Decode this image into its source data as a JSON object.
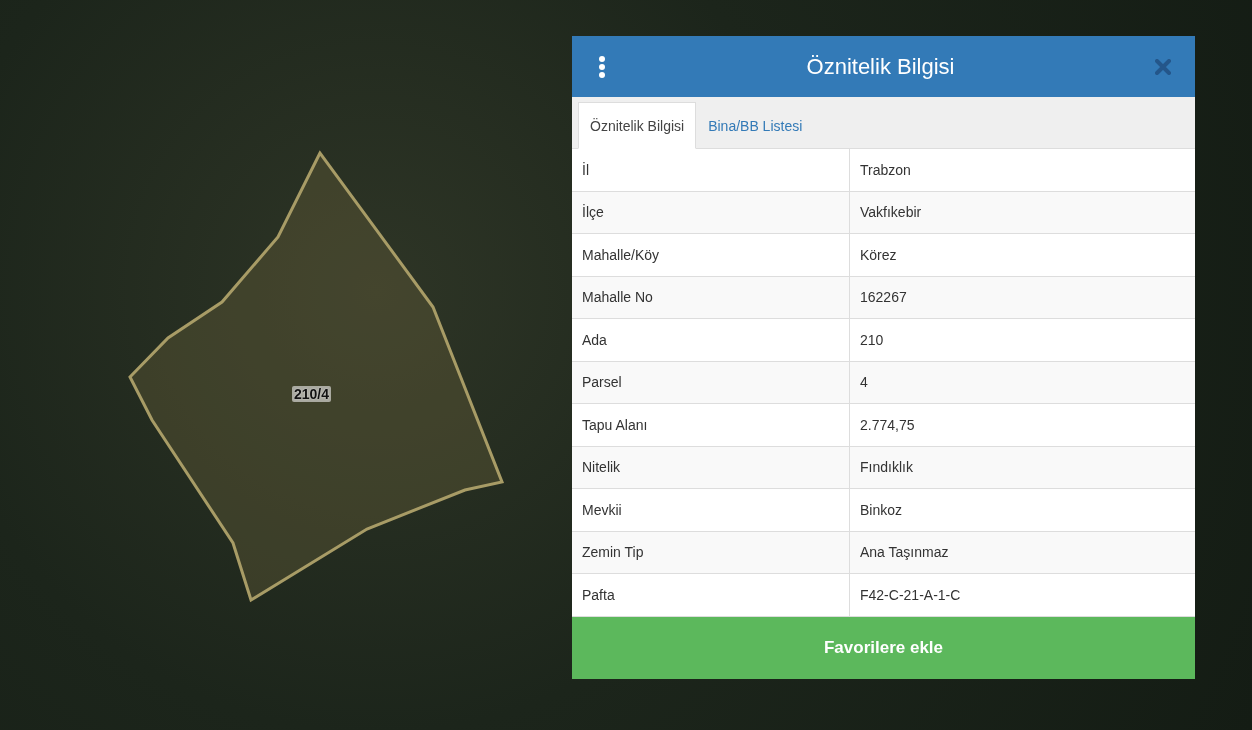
{
  "map": {
    "parcel_label": "210/4"
  },
  "panel": {
    "title": "Öznitelik Bilgisi",
    "tabs": [
      {
        "label": "Öznitelik Bilgisi",
        "selected": true
      },
      {
        "label": "Bina/BB Listesi",
        "selected": false
      }
    ],
    "rows": [
      {
        "label": "İl",
        "value": "Trabzon"
      },
      {
        "label": "İlçe",
        "value": "Vakfıkebir"
      },
      {
        "label": "Mahalle/Köy",
        "value": "Körez"
      },
      {
        "label": "Mahalle No",
        "value": "162267"
      },
      {
        "label": "Ada",
        "value": "210"
      },
      {
        "label": "Parsel",
        "value": "4"
      },
      {
        "label": "Tapu Alanı",
        "value": "2.774,75"
      },
      {
        "label": "Nitelik",
        "value": "Fındıklık"
      },
      {
        "label": "Mevkii",
        "value": "Binkoz"
      },
      {
        "label": "Zemin Tip",
        "value": "Ana Taşınmaz"
      },
      {
        "label": "Pafta",
        "value": "F42-C-21-A-1-C"
      }
    ],
    "button": "Favorilere ekle"
  }
}
